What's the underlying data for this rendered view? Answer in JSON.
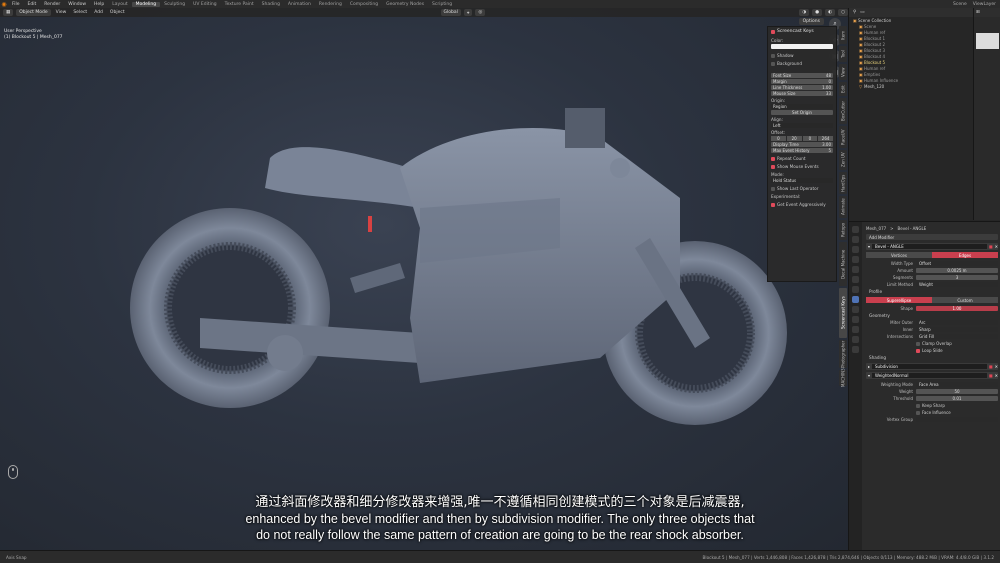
{
  "topbar": {
    "menus": [
      "File",
      "Edit",
      "Render",
      "Window",
      "Help"
    ],
    "workspaces": [
      "Layout",
      "Modeling",
      "Sculpting",
      "UV Editing",
      "Texture Paint",
      "Shading",
      "Animation",
      "Rendering",
      "Compositing",
      "Geometry Nodes",
      "Scripting"
    ],
    "active_workspace": "Modeling",
    "scene": "Scene",
    "view_layer": "ViewLayer"
  },
  "viewport": {
    "mode": "Object Mode",
    "menus": [
      "View",
      "Select",
      "Add",
      "Object"
    ],
    "transform": "Global",
    "options": "Options",
    "perspective": "User Perspective",
    "object_info": "(1) Blockout 5 | Mesh_077"
  },
  "screencast": {
    "title": "Screencast Keys",
    "color_label": "Color:",
    "shadow": "Shadow",
    "background": "Background",
    "fields": [
      {
        "k": "Font Size",
        "v": "48"
      },
      {
        "k": "Margin",
        "v": "0"
      },
      {
        "k": "Line Thickness",
        "v": "1.00"
      },
      {
        "k": "Mouse Size",
        "v": "33"
      }
    ],
    "origin_label": "Origin:",
    "origin_value": "Region",
    "set_origin": "Set Origin",
    "align_label": "Align:",
    "align_value": "Left",
    "offset_label": "Offset:",
    "offset": [
      "0",
      "20",
      "0",
      "264"
    ],
    "display_time": {
      "k": "Display Time",
      "v": "3.00"
    },
    "max_history": {
      "k": "Max Event History",
      "v": "5"
    },
    "repeat_count": "Repeat Count",
    "show_mouse": "Show Mouse Events",
    "mode_label": "Mode:",
    "mode_value": "Hold Status",
    "show_last_op": "Show Last Operator",
    "experimental": "Experimental:",
    "get_event": "Get Event Aggressively"
  },
  "vtabs": [
    "Item",
    "Tool",
    "View",
    "Edit",
    "BoxCutter",
    "RaceUV",
    "Zen UV",
    "HardOps",
    "Animate",
    "Retopo",
    "Decal Machine",
    "Screencast Keys",
    "Photographer",
    "MACHIN3"
  ],
  "outliner": {
    "title": "Scene Collection",
    "items": [
      {
        "name": "Scene",
        "sel": false
      },
      {
        "name": "Human ref",
        "sel": false
      },
      {
        "name": "Blockout 1",
        "sel": false
      },
      {
        "name": "Blockout 2",
        "sel": false
      },
      {
        "name": "Blockout 3",
        "sel": false
      },
      {
        "name": "Blockout 4",
        "sel": false
      },
      {
        "name": "Blockout 5",
        "sel": true
      },
      {
        "name": "Human ref",
        "sel": false
      },
      {
        "name": "Empties",
        "sel": false
      },
      {
        "name": "Human Influence",
        "sel": false
      },
      {
        "name": "Mesh_120",
        "sel": false
      }
    ]
  },
  "properties": {
    "breadcrumb": [
      "Mesh_077",
      ">",
      "Bevel - ANGLE"
    ],
    "add_modifier": "Add Modifier",
    "bevel_name": "Bevel - ANGLE",
    "toggle": [
      "Vertices",
      "Edges"
    ],
    "rows": [
      {
        "k": "Width Type",
        "v": "Offset",
        "style": "dark"
      },
      {
        "k": "Amount",
        "v": "0.0025 m",
        "style": ""
      },
      {
        "k": "Segments",
        "v": "3",
        "style": ""
      },
      {
        "k": "Limit Method",
        "v": "Weight",
        "style": "dark"
      }
    ],
    "profile": "Profile",
    "profile_toggle": [
      "Superellipse",
      "Custom"
    ],
    "shape": {
      "k": "Shape",
      "v": "1.00"
    },
    "geometry": "Geometry",
    "geo_rows": [
      {
        "k": "Miter Outer",
        "v": "Arc"
      },
      {
        "k": "Inner",
        "v": "Sharp"
      },
      {
        "k": "Intersections",
        "v": "Grid Fill"
      }
    ],
    "clamp": "Clamp Overlap",
    "loop_slide": "Loop Slide",
    "shading": "Shading",
    "mod2": "Subdivision",
    "mod3": "WeightedNormal",
    "wn_rows": [
      {
        "k": "Weighting Mode",
        "v": "Face Area",
        "style": "dark"
      },
      {
        "k": "Weight",
        "v": "50",
        "style": ""
      },
      {
        "k": "Threshold",
        "v": "0.01",
        "style": ""
      }
    ],
    "keep_sharp": "Keep Sharp",
    "face_influence": "Face Influence",
    "vertex_group": "Vertex Group"
  },
  "statusbar": {
    "left": "Axis Snap",
    "right": "Blockout 5 | Mesh_077 | Verts 1,446,808 | Faces 1,426,878 | Tris 2,874,646 | Objects 0/113 | Memory: 488.2 MiB | VRAM: 4.4/8.0 GiB | 3.1.2"
  },
  "subtitles": {
    "zh": "通过斜面修改器和细分修改器来增强,唯一不遵循相同创建模式的三个对象是后减震器,",
    "en1": "enhanced by the bevel modifier and then by subdivision modifier. The only three objects that",
    "en2": "do not really follow the same pattern of creation are going to be the rear shock absorber."
  }
}
